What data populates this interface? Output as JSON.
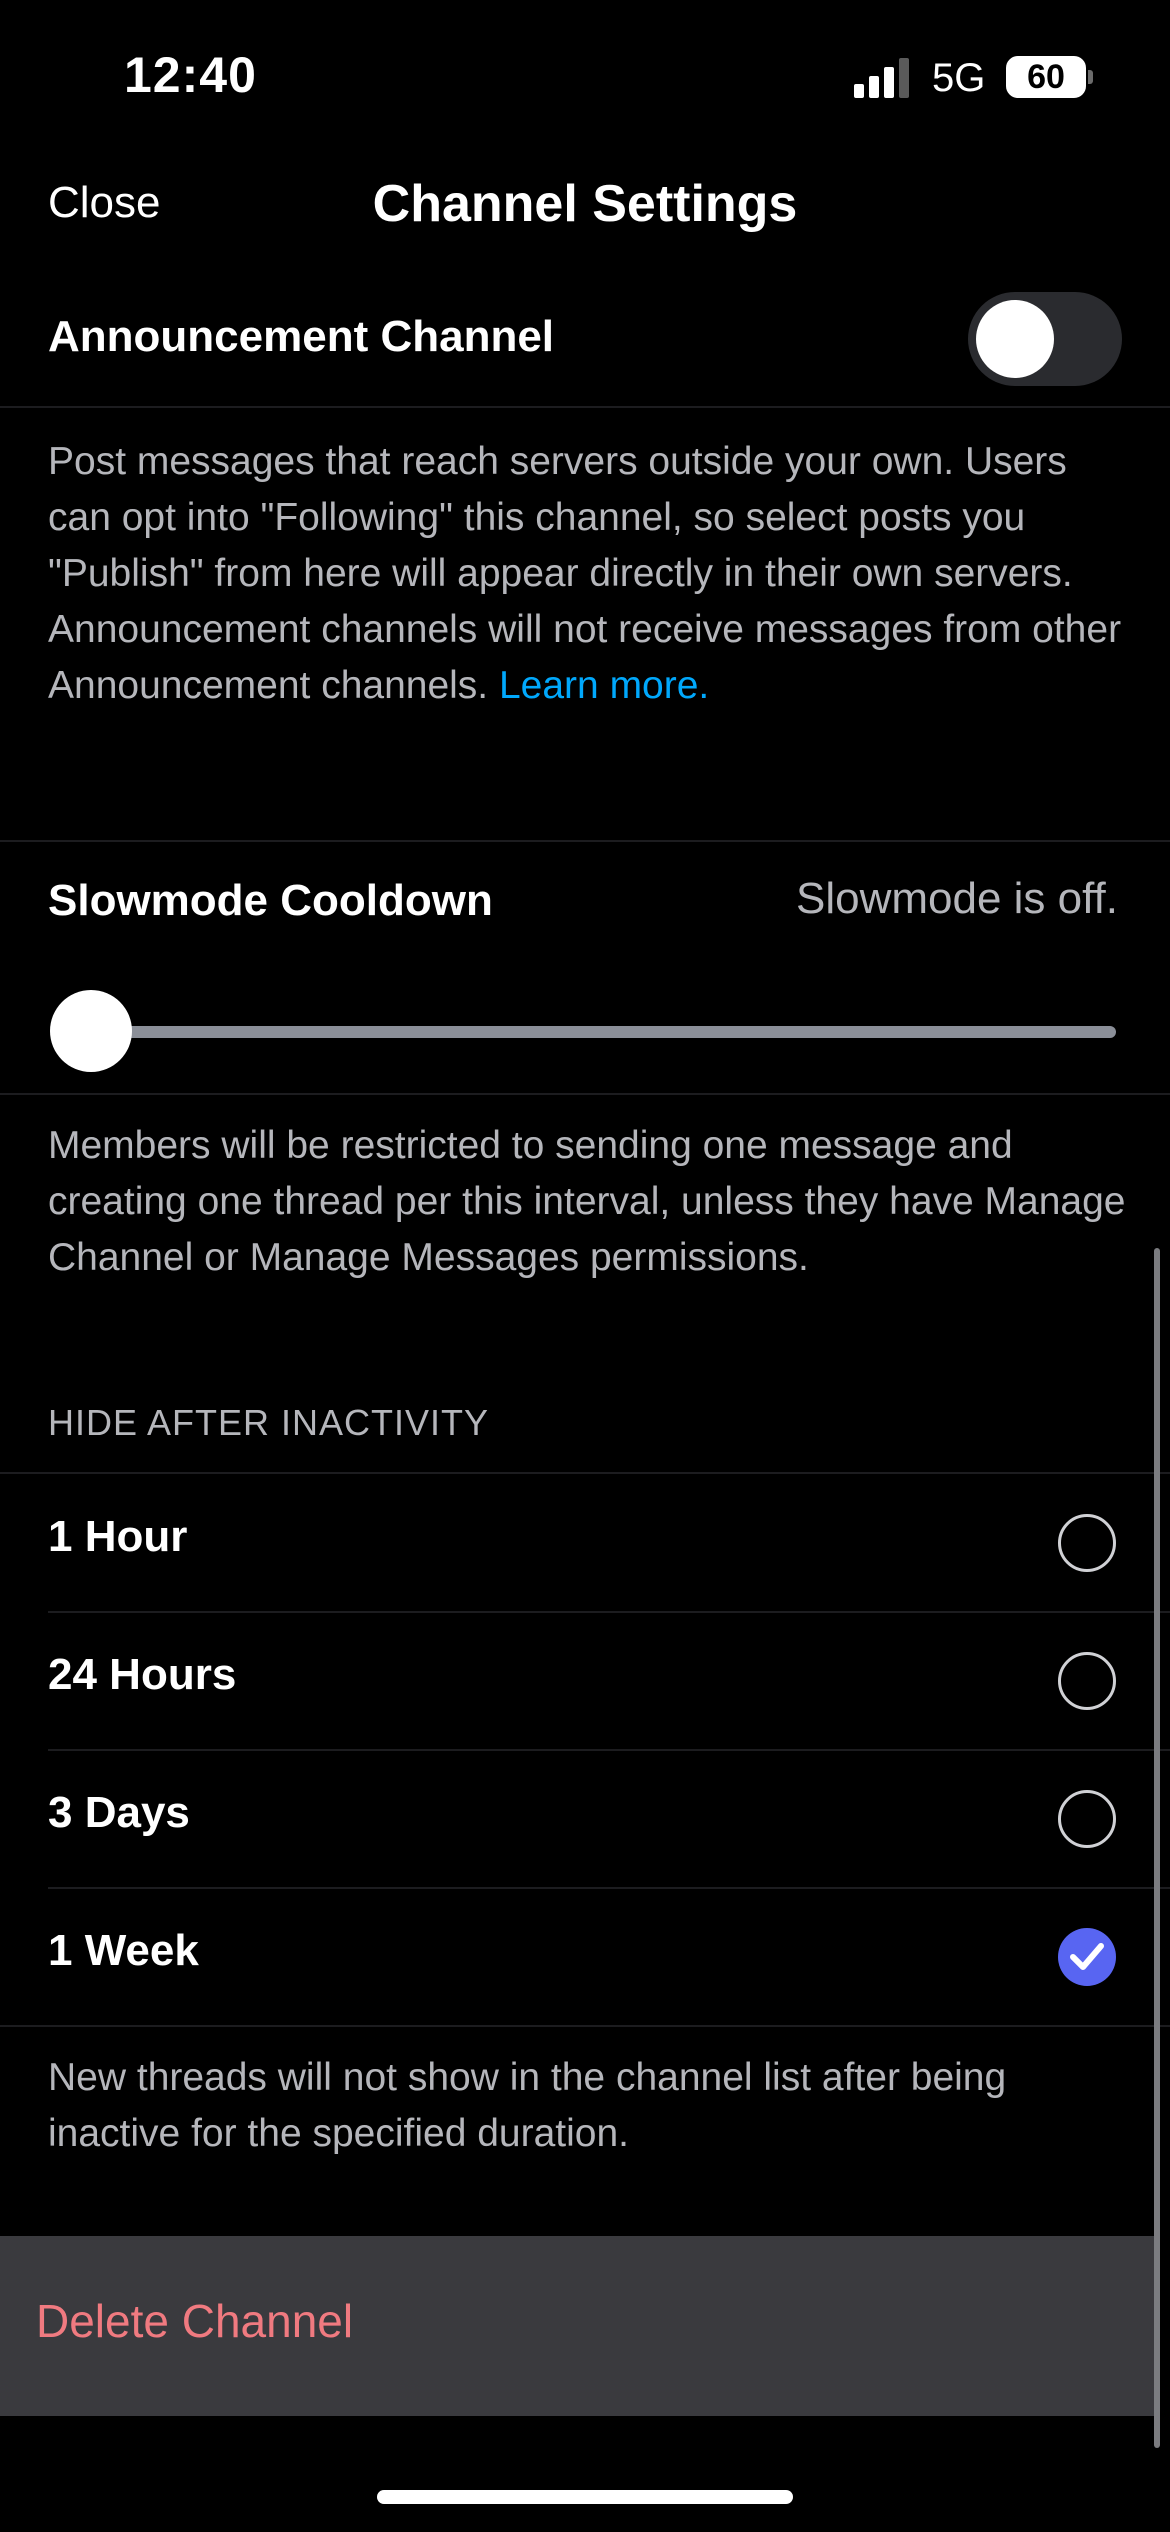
{
  "status_bar": {
    "time": "12:40",
    "network": "5G",
    "battery": "60",
    "battery_level_percent": 60
  },
  "nav": {
    "close_label": "Close",
    "title": "Channel Settings"
  },
  "announcement": {
    "label": "Announcement Channel",
    "toggle_on": false,
    "description": "Post messages that reach servers outside your own. Users can opt into \"Following\" this channel, so select posts you \"Publish\" from here will appear directly in their own servers. Announcement channels will not receive messages from other Announcement channels. ",
    "learn_more": "Learn more."
  },
  "slowmode": {
    "label": "Slowmode Cooldown",
    "status": "Slowmode is off.",
    "slider_value_fraction": 0,
    "description": "Members will be restricted to sending one message and creating one thread per this interval, unless they have Manage Channel or Manage Messages permissions."
  },
  "hide_after_inactivity": {
    "header": "HIDE AFTER INACTIVITY",
    "options": [
      {
        "label": "1 Hour",
        "selected": false
      },
      {
        "label": "24 Hours",
        "selected": false
      },
      {
        "label": "3 Days",
        "selected": false
      },
      {
        "label": "1 Week",
        "selected": true
      }
    ],
    "description": "New threads will not show in the channel list after being inactive for the specified duration."
  },
  "delete": {
    "label": "Delete Channel"
  },
  "colors": {
    "accent": "#5865f2",
    "link": "#00a8fc",
    "danger": "#f07a80",
    "background": "#000000"
  }
}
